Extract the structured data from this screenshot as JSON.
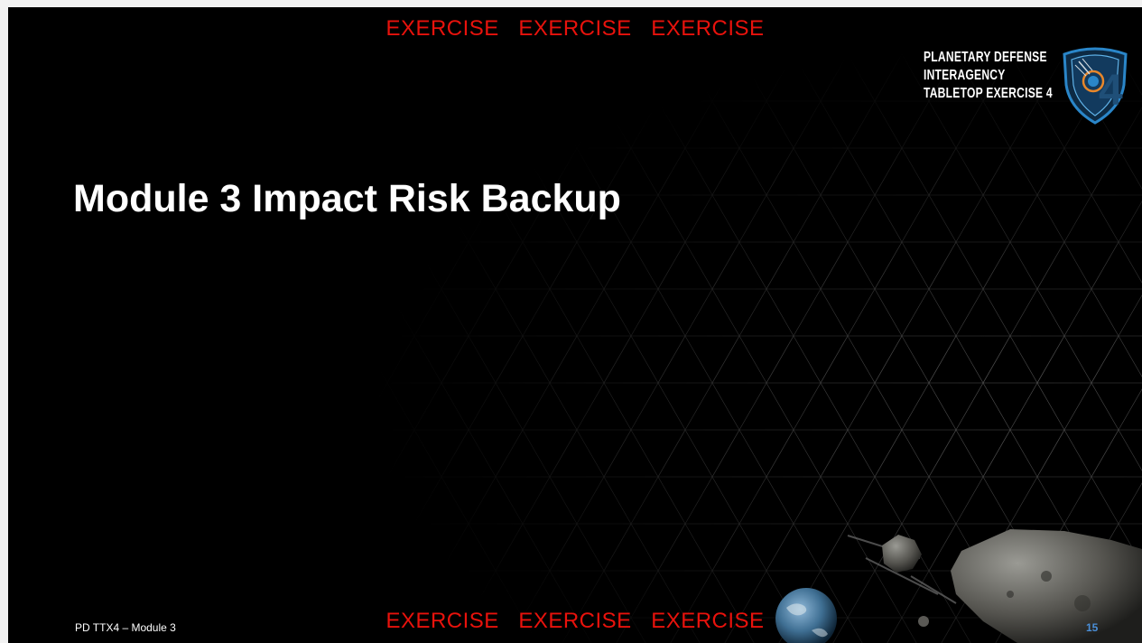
{
  "banner": {
    "top": "EXERCISE   EXERCISE   EXERCISE",
    "bottom": "EXERCISE   EXERCISE   EXERCISE",
    "color": "#e8120c"
  },
  "slide": {
    "title": "Module 3 Impact Risk Backup",
    "footer": "PD TTX4 – Module 3",
    "page_number": "15"
  },
  "logo": {
    "lines": [
      "PLANETARY DEFENSE",
      "INTERAGENCY",
      "TABLETOP EXERCISE 4"
    ],
    "icon": "planetary-defense-shield-icon",
    "accent": "#2a86c9"
  },
  "decorations": {
    "background": "triangle-grid",
    "planet": "earth-icon",
    "asteroids": [
      "asteroid-icon",
      "asteroid-icon"
    ]
  }
}
